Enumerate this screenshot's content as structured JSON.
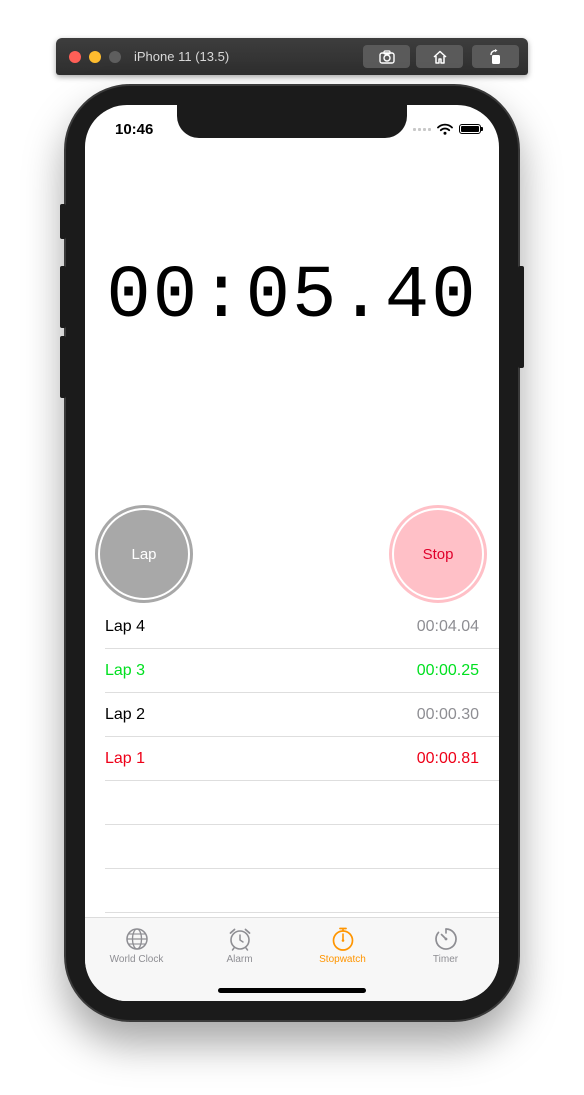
{
  "window": {
    "title": "iPhone 11 (13.5)",
    "buttons": [
      "screenshot-icon",
      "home-icon",
      "rotate-icon"
    ]
  },
  "status_bar": {
    "time": "10:46"
  },
  "stopwatch": {
    "elapsed": "00:05.40",
    "lap_button_label": "Lap",
    "stop_button_label": "Stop",
    "laps": [
      {
        "label": "Lap 4",
        "time": "00:04.04",
        "status": "normal"
      },
      {
        "label": "Lap 3",
        "time": "00:00.25",
        "status": "best"
      },
      {
        "label": "Lap 2",
        "time": "00:00.30",
        "status": "normal"
      },
      {
        "label": "Lap 1",
        "time": "00:00.81",
        "status": "worst"
      }
    ]
  },
  "tab_bar": {
    "tabs": [
      {
        "label": "World Clock",
        "icon": "globe-icon",
        "active": false
      },
      {
        "label": "Alarm",
        "icon": "alarm-clock-icon",
        "active": false
      },
      {
        "label": "Stopwatch",
        "icon": "stopwatch-icon",
        "active": true
      },
      {
        "label": "Timer",
        "icon": "timer-icon",
        "active": false
      }
    ]
  },
  "colors": {
    "accent": "#ff9500",
    "best_lap": "#00e020",
    "worst_lap": "#ee0018",
    "lap_button": "#a8a8a8",
    "stop_button": "#ffc0c7"
  }
}
